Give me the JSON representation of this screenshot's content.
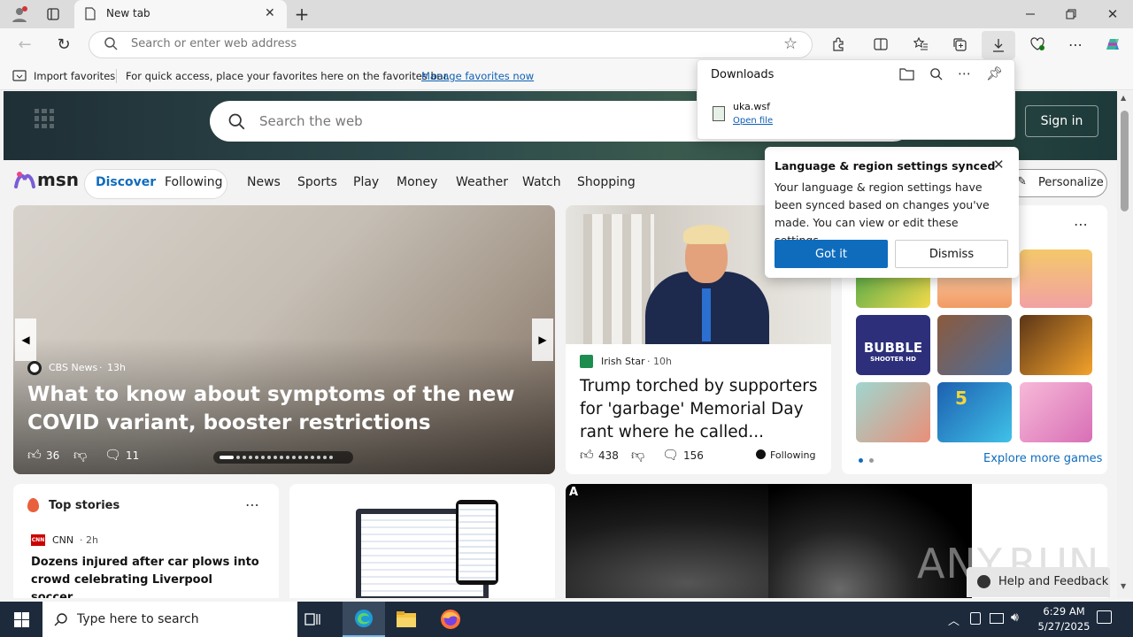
{
  "browser": {
    "tab_title": "New tab",
    "address_placeholder": "Search or enter web address"
  },
  "favorites_bar": {
    "import_label": "Import favorites",
    "hint": "For quick access, place your favorites here on the favorites bar.",
    "manage_link": "Manage favorites now"
  },
  "downloads": {
    "title": "Downloads",
    "file_name": "uka.wsf",
    "open_link": "Open file"
  },
  "msn": {
    "search_placeholder": "Search the web",
    "sign_in": "Sign in",
    "logo": "msn",
    "tabs": [
      "Discover",
      "Following"
    ],
    "nav": [
      "News",
      "Sports",
      "Play",
      "Money",
      "Weather",
      "Watch",
      "Shopping"
    ],
    "personalize": "Personalize"
  },
  "popup": {
    "title": "Language & region settings synced",
    "body": "Your language & region settings have been synced based on changes you've made. You can view or edit these settings.",
    "got_it": "Got it",
    "dismiss": "Dismiss"
  },
  "hero_story": {
    "source": "CBS News",
    "age": "13h",
    "headline": "What to know about symptoms of the new COVID variant, booster restrictions",
    "likes": "36",
    "comments": "11"
  },
  "trump_story": {
    "source": "Irish Star",
    "age": "10h",
    "headline": "Trump torched by supporters for 'garbage' Memorial Day rant where he called...",
    "likes": "438",
    "comments": "156",
    "following": "Following"
  },
  "games": {
    "explore": "Explore more games",
    "bubble_title": "BUBBLE",
    "bubble_sub": "SHOOTER HD",
    "five": "5"
  },
  "top_stories": {
    "title": "Top stories",
    "source": "CNN",
    "source_logo": "CNN",
    "age": "2h",
    "headline": "Dozens injured after car plows into crowd celebrating Liverpool soccer..."
  },
  "image_label": "A",
  "watermark": "ANY.RUN",
  "help_feedback": "Help and Feedback",
  "taskbar": {
    "search_placeholder": "Type here to search",
    "time": "6:29 AM",
    "date": "5/27/2025"
  },
  "colors": {
    "accent": "#0f6cbd",
    "taskbar": "#1c2a3c"
  }
}
